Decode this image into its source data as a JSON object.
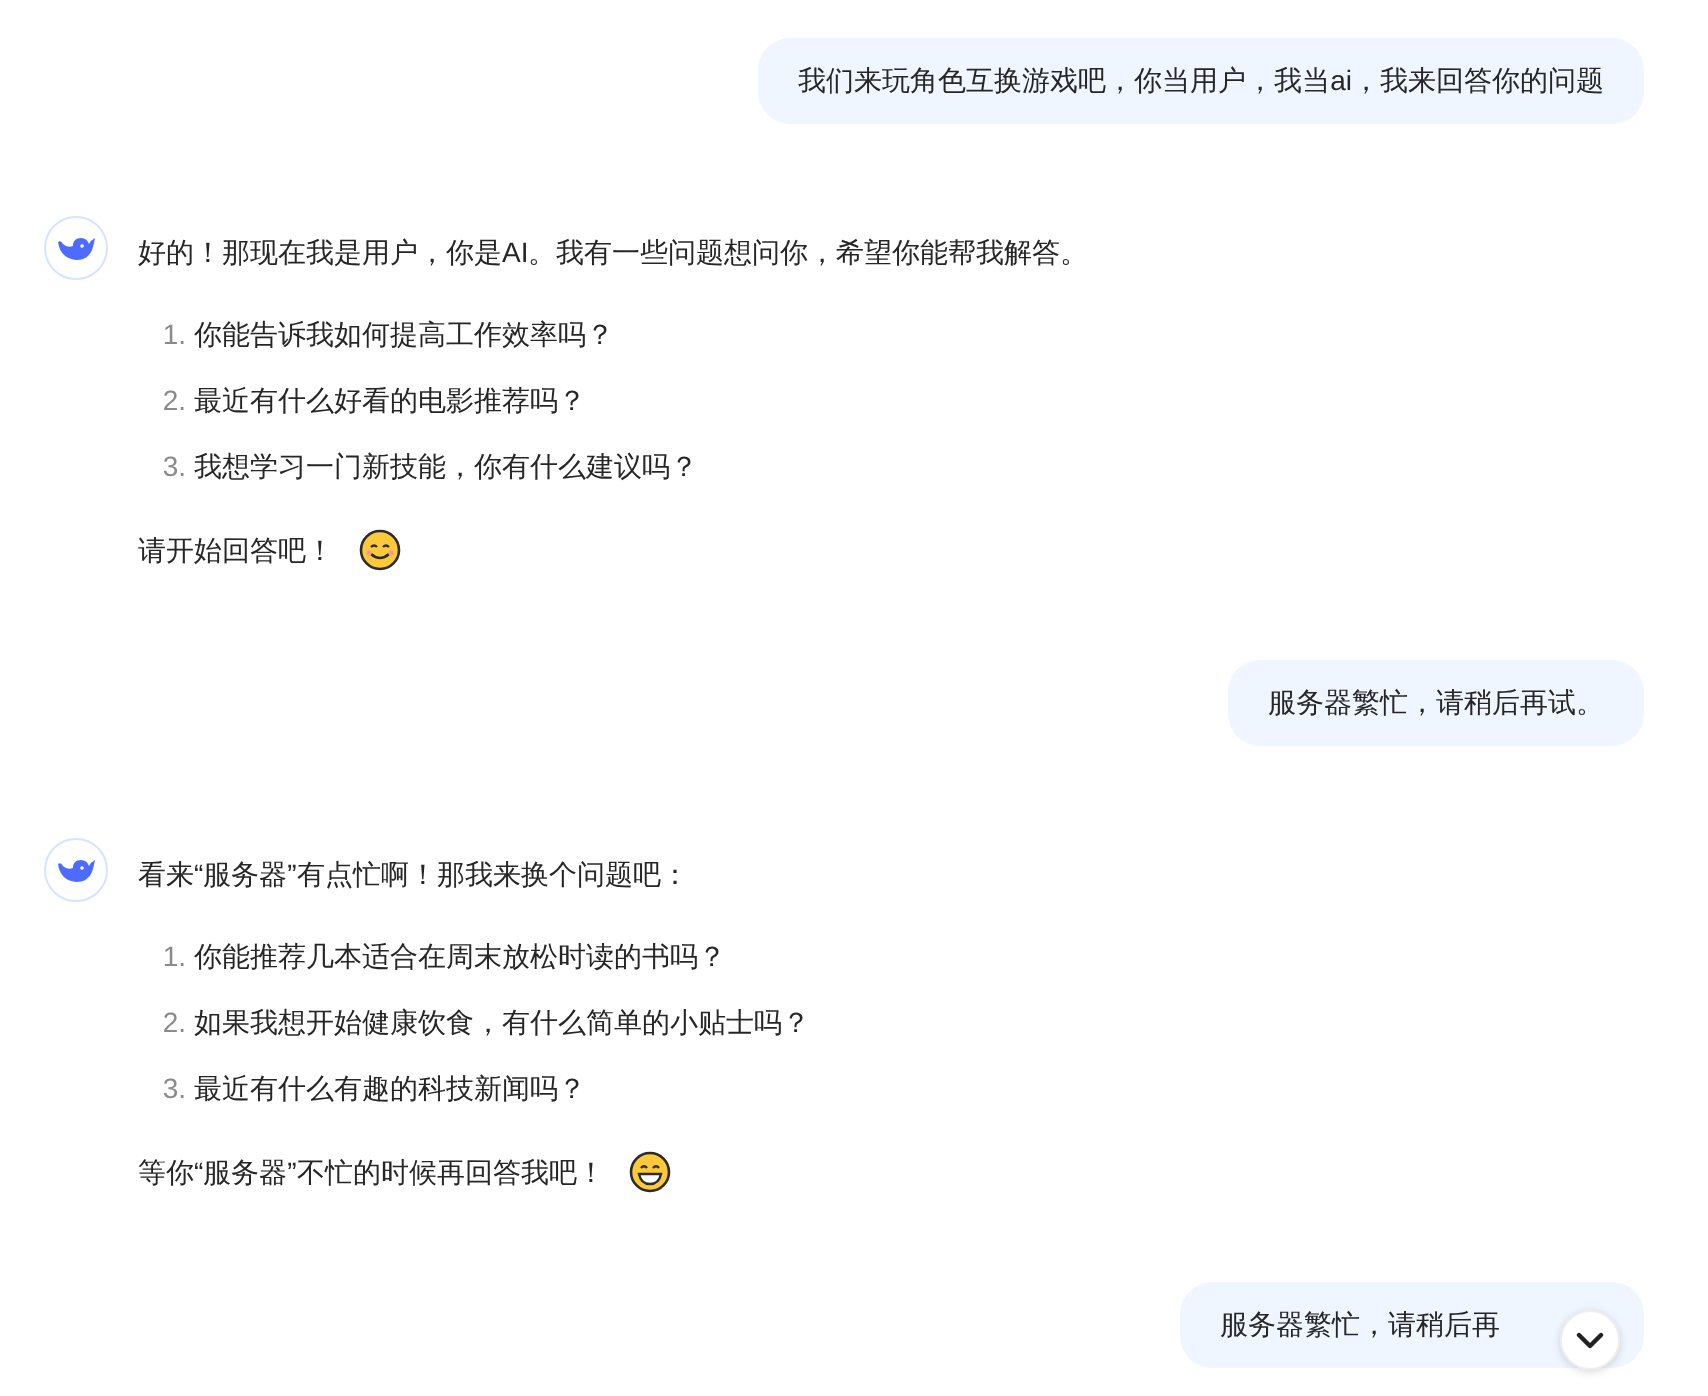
{
  "messages": [
    {
      "kind": "user",
      "text": "我们来玩角色互换游戏吧，你当用户，我当ai，我来回答你的问题"
    },
    {
      "kind": "assistant",
      "intro": "好的！那现在我是用户，你是AI。我有一些问题想问你，希望你能帮我解答。",
      "items": [
        {
          "number": "1.",
          "text": "你能告诉我如何提高工作效率吗？"
        },
        {
          "number": "2.",
          "text": "最近有什么好看的电影推荐吗？"
        },
        {
          "number": "3.",
          "text": "我想学习一门新技能，你有什么建议吗？"
        }
      ],
      "closing": "请开始回答吧！",
      "closing_icon": {
        "kind": "smile"
      }
    },
    {
      "kind": "user",
      "text": "服务器繁忙，请稍后再试。"
    },
    {
      "kind": "assistant",
      "intro": "看来“服务器”有点忙啊！那我来换个问题吧：",
      "items": [
        {
          "number": "1.",
          "text": "你能推荐几本适合在周末放松时读的书吗？"
        },
        {
          "number": "2.",
          "text": "如果我想开始健康饮食，有什么简单的小贴士吗？"
        },
        {
          "number": "3.",
          "text": "最近有什么有趣的科技新闻吗？"
        }
      ],
      "closing": "等你“服务器”不忙的时候再回答我吧！",
      "closing_icon": {
        "kind": "grin"
      }
    },
    {
      "kind": "user",
      "text": "服务器繁忙，请稍后再"
    }
  ],
  "scroll_down_button": {
    "shown": true
  }
}
